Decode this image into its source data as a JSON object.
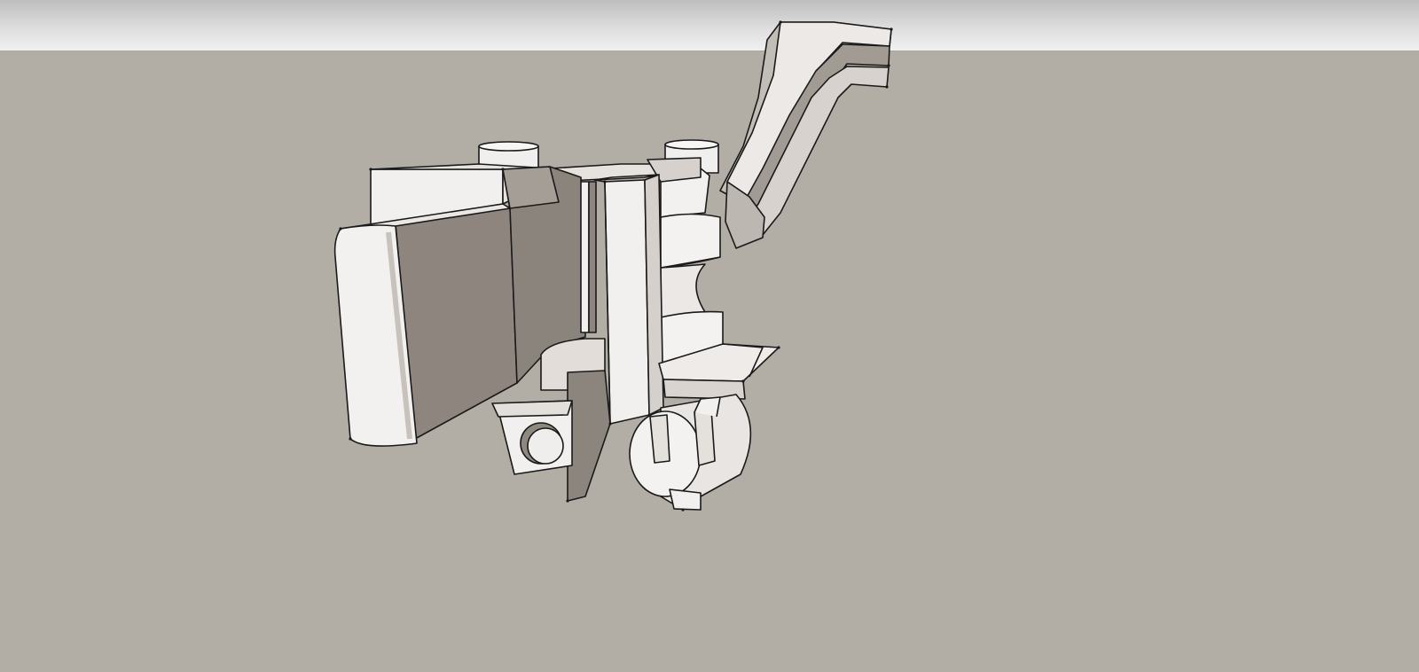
{
  "app": {
    "view": "3d-modeling-viewport",
    "scene": "mechanical-part-model"
  },
  "colors": {
    "sky_top": "#bdbdbd",
    "sky_bottom": "#f1f1f1",
    "ground": "#b2ada5",
    "face_light": "#f2f0ef",
    "face_mid": "#c9c3bd",
    "face_shadow": "#8f8881",
    "edge": "#1a1a1a"
  }
}
